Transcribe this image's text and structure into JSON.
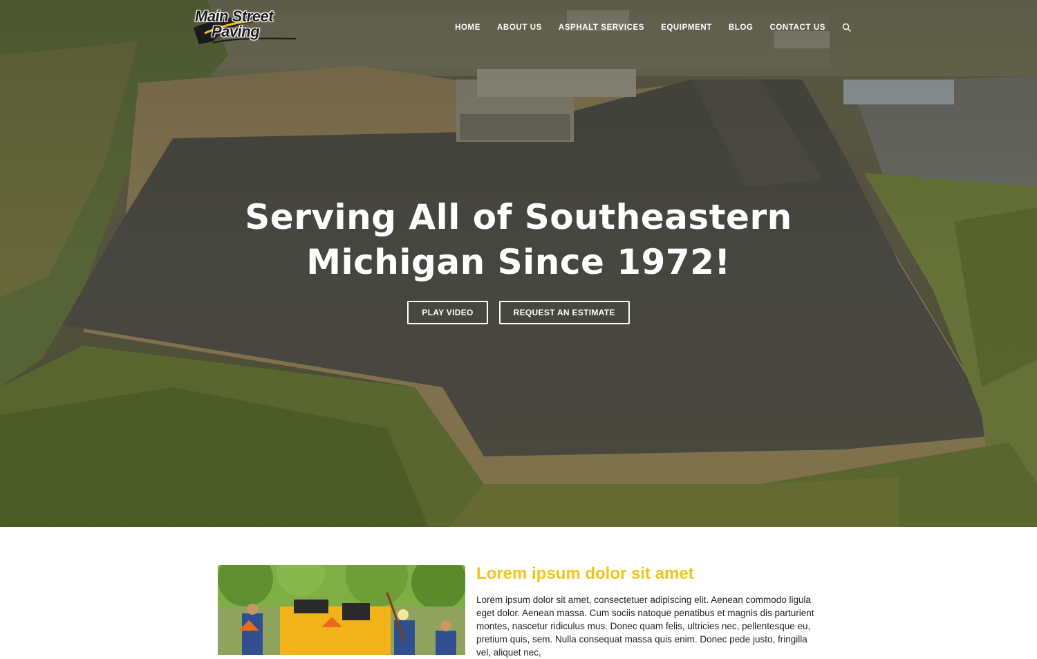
{
  "logo": {
    "line1": "Main Street",
    "line2": "Paving"
  },
  "nav": {
    "items": [
      {
        "label": "HOME"
      },
      {
        "label": "ABOUT US"
      },
      {
        "label": "ASPHALT SERVICES"
      },
      {
        "label": "EQUIPMENT"
      },
      {
        "label": "BLOG"
      },
      {
        "label": "CONTACT US"
      }
    ],
    "search_icon": "search-icon"
  },
  "hero": {
    "title": "Serving All of Southeastern Michigan Since 1972!",
    "buttons": {
      "play_video": "PLAY VIDEO",
      "estimate": "REQUEST AN ESTIMATE"
    }
  },
  "intro": {
    "heading": "Lorem ipsum dolor sit amet",
    "body": "Lorem ipsum dolor sit amet, consectetuer adipiscing elit. Aenean commodo ligula eget dolor. Aenean massa. Cum sociis natoque penatibus et magnis dis parturient montes, nascetur ridiculus mus. Donec quam felis, ultricies nec, pellentesque eu, pretium quis, sem. Nulla consequat massa quis enim. Donec pede justo, fringilla vel, aliquet nec,",
    "heading_color": "#f2c419"
  }
}
